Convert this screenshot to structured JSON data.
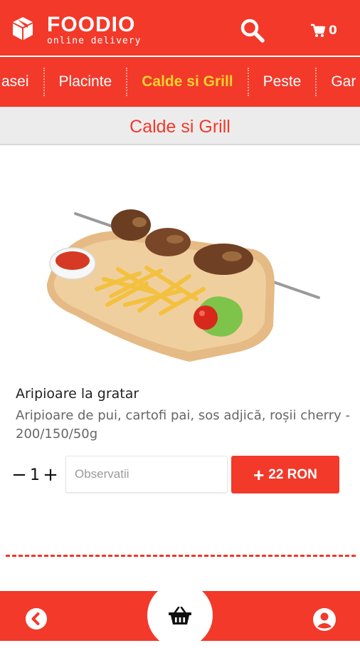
{
  "header": {
    "brand_name": "FOODIO",
    "brand_tagline": "online delivery",
    "cart_count": "0",
    "accent_color": "#f2392a"
  },
  "nav": {
    "items": [
      {
        "label": "asei"
      },
      {
        "label": "Placinte"
      },
      {
        "label": "Calde si Grill",
        "active": true
      },
      {
        "label": "Peste"
      },
      {
        "label": "Gar"
      }
    ],
    "active_color": "#ffd22e"
  },
  "category": {
    "title": "Calde si Grill"
  },
  "product": {
    "image_icon": "grilled-chicken-wings-platter",
    "name": "Aripioare la gratar",
    "description": "Aripioare de pui, cartofi pai, sos adjică, roșii cherry - 200/150/50g",
    "quantity": "1",
    "notes_placeholder": "Observatii",
    "add_label": "22 RON"
  },
  "footer": {
    "back_icon": "chevron-left-icon",
    "basket_icon": "basket-icon",
    "profile_icon": "user-icon"
  }
}
